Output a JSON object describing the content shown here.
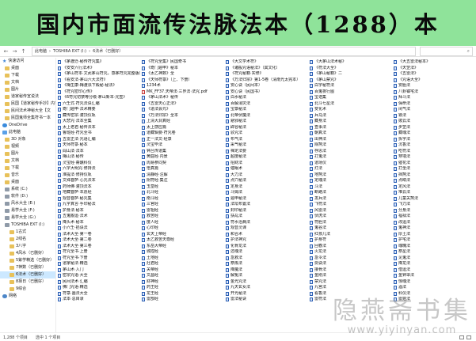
{
  "banner": {
    "title": "国内市面流传法脉法本（1288）本"
  },
  "address_bar": {
    "back": "←",
    "forward": "→",
    "up": "↑",
    "path": [
      "此电脑",
      "TOSHIBA EXT (I:)",
      "6法术（已删好）"
    ],
    "separator": "›",
    "search_icon": "search-icon"
  },
  "sidebar": {
    "items": [
      {
        "label": "快速访问",
        "icon": "star",
        "level": "head"
      },
      {
        "label": "桌面",
        "icon": "folder",
        "level": "item"
      },
      {
        "label": "下载",
        "icon": "folder",
        "level": "item"
      },
      {
        "label": "文档",
        "icon": "folder",
        "level": "item"
      },
      {
        "label": "图片",
        "icon": "folder",
        "level": "item"
      },
      {
        "label": "道家秘传宣说法",
        "icon": "folder",
        "level": "item"
      },
      {
        "label": "民国【道家秘传手抄】内容全部",
        "icon": "folder",
        "level": "item"
      },
      {
        "label": "民间法术神秘大全【文",
        "icon": "folder",
        "level": "item"
      },
      {
        "label": "民国鬼师全集符书一本",
        "icon": "folder",
        "level": "item"
      },
      {
        "label": "OneDrive",
        "icon": "cloud",
        "level": "head"
      },
      {
        "label": "此电脑",
        "icon": "pc",
        "level": "head"
      },
      {
        "label": "3D 对象",
        "icon": "folder",
        "level": "item"
      },
      {
        "label": "视频",
        "icon": "folder",
        "level": "item"
      },
      {
        "label": "图片",
        "icon": "folder",
        "level": "item"
      },
      {
        "label": "文档",
        "icon": "folder",
        "level": "item"
      },
      {
        "label": "下载",
        "icon": "folder",
        "level": "item"
      },
      {
        "label": "音乐",
        "icon": "folder",
        "level": "item"
      },
      {
        "label": "桌面",
        "icon": "folder",
        "level": "item"
      },
      {
        "label": "系统 (C:)",
        "icon": "drive",
        "level": "item"
      },
      {
        "label": "软件 (D:)",
        "icon": "drive",
        "level": "item"
      },
      {
        "label": "风水大全 (E:)",
        "icon": "drive",
        "level": "item"
      },
      {
        "label": "易学大全 (F:)",
        "icon": "drive",
        "level": "item"
      },
      {
        "label": "易学大全 (G:)",
        "icon": "drive",
        "level": "item"
      },
      {
        "label": "TOSHIBA EXT (I:)",
        "icon": "drive",
        "level": "item"
      },
      {
        "label": "1古式",
        "icon": "folder",
        "level": "indent"
      },
      {
        "label": "2线名",
        "icon": "folder",
        "level": "indent"
      },
      {
        "label": "3八字",
        "icon": "folder",
        "level": "indent"
      },
      {
        "label": "4风水（已删好）",
        "icon": "folder",
        "level": "indent"
      },
      {
        "label": "5紫学精选（已删好）",
        "icon": "folder",
        "level": "indent"
      },
      {
        "label": "7神数（已删好）",
        "icon": "folder",
        "level": "indent"
      },
      {
        "label": "6法术（已删好）",
        "icon": "folder",
        "level": "indent",
        "selected": true
      },
      {
        "label": "8择日（已删好）",
        "icon": "folder",
        "level": "indent"
      },
      {
        "label": "9综合",
        "icon": "folder",
        "level": "indent"
      },
      {
        "label": "网络",
        "icon": "net",
        "level": "head"
      }
    ]
  },
  "columns": [
    {
      "files": [
        {
          "name": "《茅渡迁-秘传符咒集》",
          "t": "w"
        },
        {
          "name": "《安安六行法术》",
          "t": "w"
        },
        {
          "name": "《茅山符本·文武茅山符咒，感茅符咒完整版》",
          "t": "w"
        },
        {
          "name": "《看安法-茅山六大法符》",
          "t": "w"
        },
        {
          "name": "《梅生康-梅渡派下殿秘·秘法》",
          "t": "w"
        },
        {
          "name": "《符咒密印心传》",
          "t": "w"
        },
        {
          "name": "《6符咒初禁等分级·茅山新本·咒签》",
          "t": "w"
        },
        {
          "name": "六壬式·符咒法诀汇编",
          "t": "w"
        },
        {
          "name": "奇门遁甲·法术精要",
          "t": "w"
        },
        {
          "name": "藏传密宗·灌顶仪轨",
          "t": "w"
        },
        {
          "name": "大悲咒·法本全集",
          "t": "w"
        },
        {
          "name": "太上老君·秘传法本",
          "t": "w"
        },
        {
          "name": "鲁班经·符咒全书",
          "t": "w"
        },
        {
          "name": "五雷正法·咒语汇编",
          "t": "w"
        },
        {
          "name": "天师符箓·秘本",
          "t": "w"
        },
        {
          "name": "闾山法·法本",
          "t": "w"
        },
        {
          "name": "梅山法·秘传",
          "t": "w"
        },
        {
          "name": "灵宝经·斋醮科仪",
          "t": "w"
        },
        {
          "name": "六字大明咒·修持法",
          "t": "w"
        },
        {
          "name": "准提法·修持仪轨",
          "t": "w"
        },
        {
          "name": "文殊菩萨·心咒法本",
          "t": "w"
        },
        {
          "name": "药师佛·灌顶法本",
          "t": "w"
        },
        {
          "name": "地藏菩萨·本愿经",
          "t": "w"
        },
        {
          "name": "观音菩萨·秘咒集",
          "t": "w"
        },
        {
          "name": "九字真言·手印秘法",
          "t": "w"
        },
        {
          "name": "护身法·秘本",
          "t": "w"
        },
        {
          "name": "五鬼搬运·法术",
          "t": "w"
        },
        {
          "name": "降头术·秘本",
          "t": "w"
        },
        {
          "name": "小六壬·掐诀法",
          "t": "w"
        },
        {
          "name": "法术大全·第一卷",
          "t": "w"
        },
        {
          "name": "法术大全·第二卷",
          "t": "w"
        },
        {
          "name": "法术大全·第三卷",
          "t": "w"
        },
        {
          "name": "符咒全书·上册",
          "t": "w"
        },
        {
          "name": "符咒全书·下册",
          "t": "w"
        },
        {
          "name": "道家秘法·精选",
          "t": "w"
        },
        {
          "name": "茅山术·入门",
          "t": "w"
        },
        {
          "name": "密宗咒语·大全",
          "t": "w"
        },
        {
          "name": "民间法术·汇编",
          "t": "w"
        },
        {
          "name": "佛门咒语·精选",
          "t": "w"
        },
        {
          "name": "符箓·画法大全",
          "t": "w"
        },
        {
          "name": "法本·总目录",
          "t": "w"
        }
      ]
    },
    {
      "files": [
        {
          "name": "《符咒全集》民国奇书",
          "t": "w"
        },
        {
          "name": "《奇门遁甲》秘本",
          "t": "w"
        },
        {
          "name": "《太乙神数》全",
          "t": "w"
        },
        {
          "name": "《天师符箓》（上、下册）",
          "t": "w"
        },
        {
          "name": "1234术",
          "t": "w"
        },
        {
          "name": "MK_FF37.天帝法·三界法·法咒.pdf",
          "t": "p"
        },
        {
          "name": "《茅山法术》秘传",
          "t": "w"
        },
        {
          "name": "《五雷天心正法》",
          "t": "w"
        },
        {
          "name": "《道法会元》",
          "t": "w"
        },
        {
          "name": "《万法归宗》全本",
          "t": "w"
        },
        {
          "name": "上清大洞真经",
          "t": "w"
        },
        {
          "name": "太上感应篇",
          "t": "w"
        },
        {
          "name": "道藏辑要·符咒卷",
          "t": "w"
        },
        {
          "name": "正一法文·经箓",
          "t": "w"
        },
        {
          "name": "灵宝毕法",
          "t": "w"
        },
        {
          "name": "钟吕传道集",
          "t": "w"
        },
        {
          "name": "黄庭经·内景",
          "t": "w"
        },
        {
          "name": "周易参同契",
          "t": "w"
        },
        {
          "name": "悟真篇",
          "t": "w"
        },
        {
          "name": "清静经·注解",
          "t": "w"
        },
        {
          "name": "阴符经·集注",
          "t": "w"
        },
        {
          "name": "玉皇经",
          "t": "w"
        },
        {
          "name": "北斗经",
          "t": "w"
        },
        {
          "name": "南斗经",
          "t": "w"
        },
        {
          "name": "三官经",
          "t": "w"
        },
        {
          "name": "雷祖经",
          "t": "w"
        },
        {
          "name": "救苦经",
          "t": "w"
        },
        {
          "name": "度人经",
          "t": "w"
        },
        {
          "name": "心印经",
          "t": "w"
        },
        {
          "name": "玄天上帝经",
          "t": "w"
        },
        {
          "name": "太乙救苦天尊经",
          "t": "w"
        },
        {
          "name": "东岳大帝经",
          "t": "w"
        },
        {
          "name": "城隍经",
          "t": "w"
        },
        {
          "name": "土地经",
          "t": "w"
        },
        {
          "name": "灶君经",
          "t": "w"
        },
        {
          "name": "关帝经",
          "t": "w"
        },
        {
          "name": "文昌经",
          "t": "w"
        },
        {
          "name": "财神经",
          "t": "w"
        },
        {
          "name": "药王经",
          "t": "w"
        },
        {
          "name": "龙王经",
          "t": "w"
        },
        {
          "name": "雷部经",
          "t": "w"
        }
      ]
    },
    {
      "files": [
        {
          "name": "《大文学术符》",
          "t": "w"
        },
        {
          "name": "《诸般咒语秘法》（其文化）",
          "t": "w"
        },
        {
          "name": "《符咒秘籍·实修》",
          "t": "w"
        },
        {
          "name": "《万法归宗》第1-5卷（清南光太完本）",
          "t": "w"
        },
        {
          "name": "安心诀（民间本）",
          "t": "w"
        },
        {
          "name": "安心诀（民国书）",
          "t": "w"
        },
        {
          "name": "白水秘法",
          "t": "w"
        },
        {
          "name": "百解消灾法",
          "t": "w"
        },
        {
          "name": "宝箓秘法",
          "t": "w"
        },
        {
          "name": "北帝伏魔法",
          "t": "w"
        },
        {
          "name": "避邪秘法",
          "t": "w"
        },
        {
          "name": "辟谷秘法",
          "t": "w"
        },
        {
          "name": "驳咒法",
          "t": "w"
        },
        {
          "name": "布气法",
          "t": "w"
        },
        {
          "name": "采气秘法",
          "t": "w"
        },
        {
          "name": "禅定法要",
          "t": "w"
        },
        {
          "name": "超度秘法",
          "t": "w"
        },
        {
          "name": "招财法",
          "t": "w"
        },
        {
          "name": "催眠术",
          "t": "w"
        },
        {
          "name": "大力法",
          "t": "w"
        },
        {
          "name": "点穴秘法",
          "t": "w"
        },
        {
          "name": "定身法",
          "t": "w"
        },
        {
          "name": "斗姆法",
          "t": "w"
        },
        {
          "name": "遁甲秘法",
          "t": "w"
        },
        {
          "name": "法坛布置法",
          "t": "w"
        },
        {
          "name": "封印秘法",
          "t": "w"
        },
        {
          "name": "扶乩法",
          "t": "w"
        },
        {
          "name": "符水治病法",
          "t": "w"
        },
        {
          "name": "观音灵课",
          "t": "w"
        },
        {
          "name": "和合术",
          "t": "w"
        },
        {
          "name": "护法神咒",
          "t": "w"
        },
        {
          "name": "化骨龙法",
          "t": "w"
        },
        {
          "name": "还魂法",
          "t": "w"
        },
        {
          "name": "急救法",
          "t": "w"
        },
        {
          "name": "祭炼法",
          "t": "w"
        },
        {
          "name": "降魔法",
          "t": "w"
        },
        {
          "name": "解冤法",
          "t": "w"
        },
        {
          "name": "金光咒法",
          "t": "w"
        },
        {
          "name": "九天玄女法",
          "t": "w"
        },
        {
          "name": "开光秘法",
          "t": "w"
        },
        {
          "name": "雷法秘诀",
          "t": "w"
        }
      ]
    },
    {
      "files": [
        {
          "name": "《大茅山法术秘》",
          "t": "w"
        },
        {
          "name": "《符法大全》",
          "t": "w"
        },
        {
          "name": "《茅山秘籍》二",
          "t": "w"
        },
        {
          "name": "《茅山禁咒》",
          "t": "w"
        },
        {
          "name": "白字秘符法",
          "t": "w"
        },
        {
          "name": "百鬼夜行图",
          "t": "w"
        },
        {
          "name": "宝诰集",
          "t": "w"
        },
        {
          "name": "北斗七星法",
          "t": "w"
        },
        {
          "name": "变化术",
          "t": "w"
        },
        {
          "name": "兵马法",
          "t": "w"
        },
        {
          "name": "藏身法",
          "t": "w"
        },
        {
          "name": "查事法",
          "t": "w"
        },
        {
          "name": "朝真法",
          "t": "w"
        },
        {
          "name": "出神法",
          "t": "w"
        },
        {
          "name": "除煞法",
          "t": "w"
        },
        {
          "name": "存思法",
          "t": "w"
        },
        {
          "name": "打鬼法",
          "t": "w"
        },
        {
          "name": "道场仪",
          "t": "w"
        },
        {
          "name": "灯法",
          "t": "w"
        },
        {
          "name": "地煞法",
          "t": "w"
        },
        {
          "name": "定魂法",
          "t": "w"
        },
        {
          "name": "斗法",
          "t": "w"
        },
        {
          "name": "断路法",
          "t": "w"
        },
        {
          "name": "发兵法",
          "t": "w"
        },
        {
          "name": "飞符法",
          "t": "w"
        },
        {
          "name": "风雷法",
          "t": "w"
        },
        {
          "name": "伏虎法",
          "t": "w"
        },
        {
          "name": "符胆法",
          "t": "w"
        },
        {
          "name": "鬼谷法",
          "t": "w"
        },
        {
          "name": "红孩儿法",
          "t": "w"
        },
        {
          "name": "护身符",
          "t": "w"
        },
        {
          "name": "回春法",
          "t": "w"
        },
        {
          "name": "火龙法",
          "t": "w"
        },
        {
          "name": "急令法",
          "t": "w"
        },
        {
          "name": "剑诀法",
          "t": "w"
        },
        {
          "name": "接骨法",
          "t": "w"
        },
        {
          "name": "金刚法",
          "t": "w"
        },
        {
          "name": "禁咒法",
          "t": "w"
        },
        {
          "name": "九宫法",
          "t": "w"
        },
        {
          "name": "看香法",
          "t": "w"
        },
        {
          "name": "雷符法",
          "t": "w"
        }
      ]
    },
    {
      "files": [
        {
          "name": "《大五雷法秘本》",
          "t": "w"
        },
        {
          "name": "《天罡法》",
          "t": "w"
        },
        {
          "name": "《五雷法》",
          "t": "w"
        },
        {
          "name": "《咒语大全》",
          "t": "w"
        },
        {
          "name": "安胎法",
          "t": "w"
        },
        {
          "name": "八卦镇宅法",
          "t": "w"
        },
        {
          "name": "拜斗法",
          "t": "w"
        },
        {
          "name": "保命法",
          "t": "w"
        },
        {
          "name": "闭气法",
          "t": "w"
        },
        {
          "name": "镖法",
          "t": "w"
        },
        {
          "name": "拨云法",
          "t": "w"
        },
        {
          "name": "步罡法",
          "t": "w"
        },
        {
          "name": "藏魂法",
          "t": "w"
        },
        {
          "name": "拆字法",
          "t": "w"
        },
        {
          "name": "沉香法",
          "t": "w"
        },
        {
          "name": "吃符法",
          "t": "w"
        },
        {
          "name": "穿墙法",
          "t": "w"
        },
        {
          "name": "催花法",
          "t": "w"
        },
        {
          "name": "打坐法",
          "t": "w"
        },
        {
          "name": "挡煞法",
          "t": "w"
        },
        {
          "name": "点睛法",
          "t": "w"
        },
        {
          "name": "定风法",
          "t": "w"
        },
        {
          "name": "堆云法",
          "t": "w"
        },
        {
          "name": "儿童关煞法",
          "t": "w"
        },
        {
          "name": "飞刀法",
          "t": "w"
        },
        {
          "name": "分身法",
          "t": "w"
        },
        {
          "name": "福禄法",
          "t": "w"
        },
        {
          "name": "改运法",
          "t": "w"
        },
        {
          "name": "鬼神法",
          "t": "w"
        },
        {
          "name": "厚土法",
          "t": "w"
        },
        {
          "name": "护宅法",
          "t": "w"
        },
        {
          "name": "魂魄法",
          "t": "w"
        },
        {
          "name": "祭星法",
          "t": "w"
        },
        {
          "name": "见鬼法",
          "t": "w"
        },
        {
          "name": "降龙法",
          "t": "w"
        },
        {
          "name": "借运法",
          "t": "w"
        },
        {
          "name": "金钟罩法",
          "t": "w"
        },
        {
          "name": "惊魂法",
          "t": "w"
        },
        {
          "name": "酒法",
          "t": "w"
        },
        {
          "name": "科仪法",
          "t": "w"
        },
        {
          "name": "雷霆法",
          "t": "w"
        }
      ]
    }
  ],
  "status_bar": {
    "count": "1,288 个项目",
    "selected": "选中 1 个项目"
  },
  "watermark": {
    "logo": "隐燕斋书集",
    "url": "www.yiyinyan.com"
  }
}
